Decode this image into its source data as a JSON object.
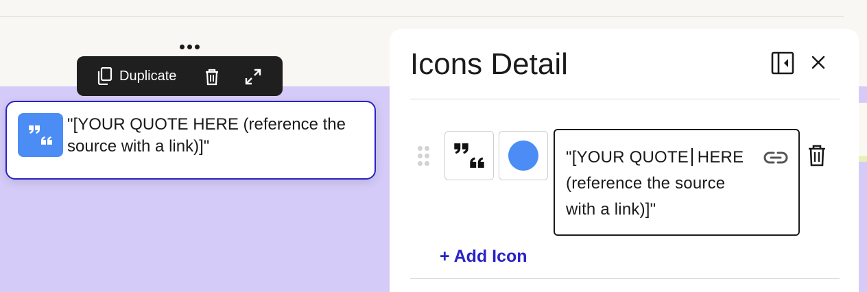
{
  "toolbar": {
    "more_icon": "more-horizontal-icon",
    "duplicate_icon": "copy-icon",
    "duplicate_label": "Duplicate",
    "delete_icon": "trash-icon",
    "expand_icon": "expand-icon"
  },
  "canvas": {
    "quote_block": {
      "icon": "quote-icon",
      "icon_color": "#4b8cf5",
      "text": "\"[YOUR QUOTE HERE (reference the source with a link)]\""
    }
  },
  "panel": {
    "title": "Icons Detail",
    "sidebar_toggle_icon": "sidebar-toggle-icon",
    "close_icon": "close-icon",
    "icon_row": {
      "drag_handle_icon": "drag-handle-icon",
      "icon": "quote-icon",
      "color": "#4b8cf5",
      "text": "\"[YOUR QUOTE HERE (reference the source with a link)]\"",
      "link_icon": "link-icon",
      "delete_icon": "trash-icon"
    },
    "add_icon_label": "+ Add Icon"
  },
  "colors": {
    "accent": "#2a23c7",
    "icon_blue": "#4b8cf5",
    "canvas_bg": "#d5cbf8",
    "toolbar_bg": "#1f1f1f"
  }
}
